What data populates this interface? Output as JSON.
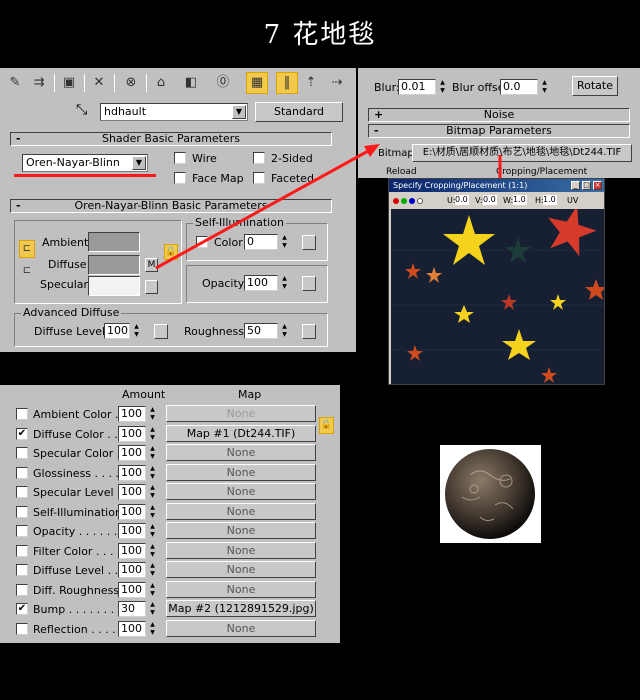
{
  "title": "7  花地毯",
  "toolbar": {
    "material_name": "hdhault",
    "type_button": "Standard"
  },
  "shader_basic": {
    "header": "Shader Basic Parameters",
    "collapse": "-",
    "shader": "Oren-Nayar-Blinn",
    "wire": "Wire",
    "two_sided": "2-Sided",
    "face_map": "Face Map",
    "faceted": "Faceted"
  },
  "onb_basic": {
    "header": "Oren-Nayar-Blinn Basic Parameters",
    "collapse": "-",
    "ambient": "Ambient:",
    "diffuse": "Diffuse:",
    "specular": "Specular:",
    "m_button": "M",
    "colors": {
      "ambient": "#9a9a9a",
      "diffuse": "#9a9a9a",
      "specular": "#f2f2f2"
    },
    "self_illum": {
      "label": "Self-Illumination",
      "color_label": "Color",
      "value": "0"
    },
    "opacity": {
      "label": "Opacity:",
      "value": "100"
    },
    "advanced": {
      "label": "Advanced Diffuse",
      "diffuse_level_label": "Diffuse Level:",
      "diffuse_level": "100",
      "roughness_label": "Roughness:",
      "roughness": "50"
    }
  },
  "bitmap": {
    "blur_label": "Blur:",
    "blur": "0.01",
    "blur_offset_label": "Blur offset:",
    "blur_offset": "0.0",
    "rotate": "Rotate",
    "noise_header": "Noise",
    "noise_pm": "+",
    "bitmap_header": "Bitmap Parameters",
    "bitmap_pm": "-",
    "bitmap_label": "Bitmap:",
    "path": "E:\\材质\\居顺材质\\布艺\\地毯\\地毯\\Dt244.TIF",
    "reload": "Reload",
    "cropping": "Cropping/Placement"
  },
  "crop_window": {
    "title": "Specify Cropping/Placement (1:1)",
    "u_label": "U:",
    "u": "0.0",
    "v_label": "V:",
    "v": "0.0",
    "w_label": "W:",
    "w": "1.0",
    "h_label": "H:",
    "h": "1.0",
    "uv": "UV"
  },
  "maps": {
    "amount_header": "Amount",
    "map_header": "Map",
    "rows": [
      {
        "label": "Ambient Color . . .",
        "checked": false,
        "amount": "100",
        "map": "None",
        "disabled": true
      },
      {
        "label": "Diffuse Color . . .",
        "checked": true,
        "amount": "100",
        "map": "Map #1 (Dt244.TIF)",
        "disabled": false
      },
      {
        "label": "Specular Color . .",
        "checked": false,
        "amount": "100",
        "map": "None",
        "disabled": false
      },
      {
        "label": "Glossiness . . . . .",
        "checked": false,
        "amount": "100",
        "map": "None",
        "disabled": false
      },
      {
        "label": "Specular Level . .",
        "checked": false,
        "amount": "100",
        "map": "None",
        "disabled": false
      },
      {
        "label": "Self-Illumination .",
        "checked": false,
        "amount": "100",
        "map": "None",
        "disabled": false
      },
      {
        "label": "Opacity . . . . . . .",
        "checked": false,
        "amount": "100",
        "map": "None",
        "disabled": false
      },
      {
        "label": "Filter Color . . . . .",
        "checked": false,
        "amount": "100",
        "map": "None",
        "disabled": false
      },
      {
        "label": "Diffuse Level . . .",
        "checked": false,
        "amount": "100",
        "map": "None",
        "disabled": false
      },
      {
        "label": "Diff. Roughness .",
        "checked": false,
        "amount": "100",
        "map": "None",
        "disabled": false
      },
      {
        "label": "Bump . . . . . . . . .",
        "checked": true,
        "amount": "30",
        "map": "Map #2 (1212891529.jpg)",
        "disabled": false
      },
      {
        "label": "Reflection . . . . .",
        "checked": false,
        "amount": "100",
        "map": "None",
        "disabled": false
      }
    ]
  },
  "colors": {
    "panel": "#c0c0c0",
    "annotation_red": "#ff1a1a",
    "active_yellow": "#f2c94c",
    "star_yellow": "#f5d31c",
    "star_red": "#d63a2a"
  }
}
